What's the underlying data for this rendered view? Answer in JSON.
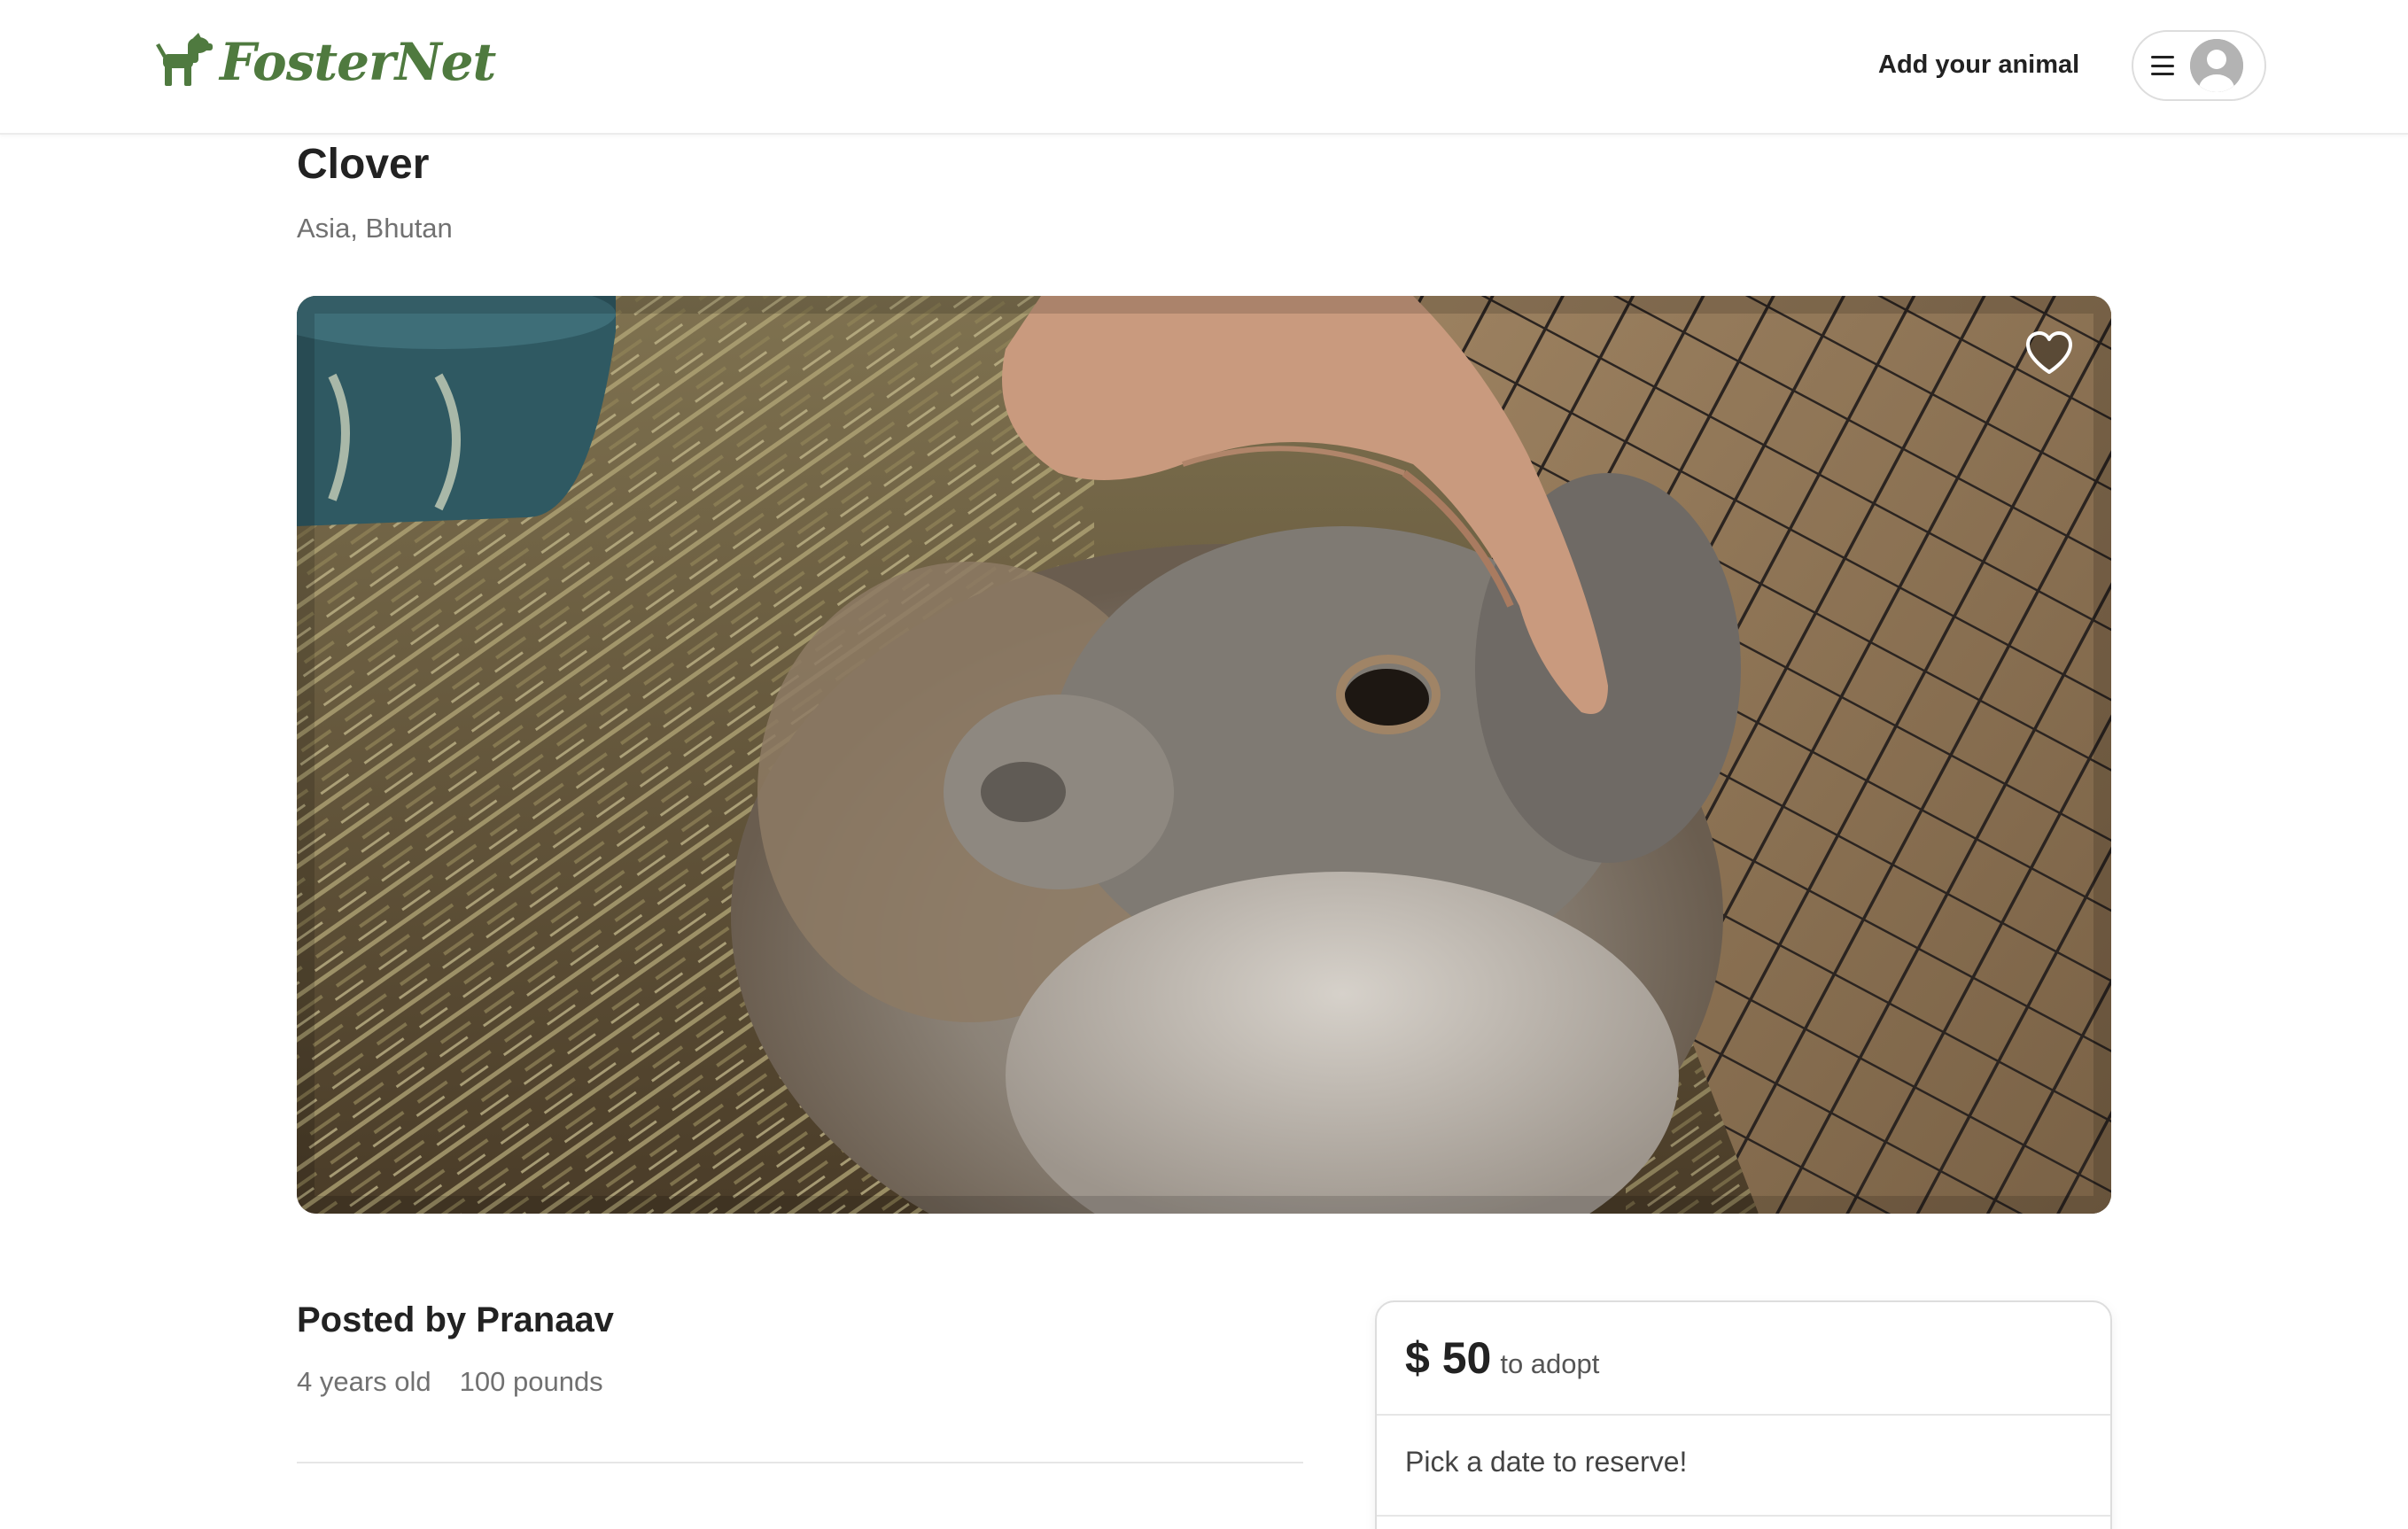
{
  "header": {
    "logo_text": "FosterNet",
    "add_animal_label": "Add your animal"
  },
  "listing": {
    "name": "Clover",
    "location": "Asia, Bhutan",
    "posted_by": "Posted by Pranaav",
    "age": "4 years old",
    "weight": "100 pounds"
  },
  "reserve": {
    "price": "$ 50",
    "price_suffix": "to adopt",
    "pick_date_prompt": "Pick a date to reserve!"
  },
  "icons": {
    "logo": "dog-icon",
    "menu": "hamburger-menu-icon",
    "avatar": "user-avatar-icon",
    "favorite": "heart-icon"
  },
  "colors": {
    "brand_green": "#4f7a3f",
    "text_primary": "#222222",
    "text_secondary": "#717171",
    "border": "#dddddd"
  }
}
